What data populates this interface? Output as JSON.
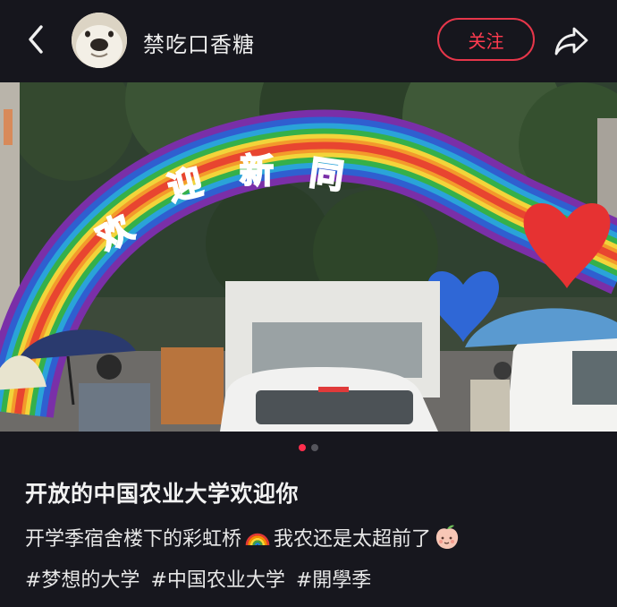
{
  "header": {
    "username": "禁吃口香糖",
    "follow_label": "关注"
  },
  "photo": {
    "arch_text": [
      "欢",
      "迎",
      "新",
      "同"
    ]
  },
  "carousel": {
    "total": 2,
    "active_index": 1
  },
  "post": {
    "title": "开放的中国农业大学欢迎你",
    "desc_before": "开学季宿舍楼下的彩虹桥",
    "desc_after": "我农还是太超前了",
    "emoji_1": "rainbow-icon",
    "emoji_2": "peach-face-icon",
    "tags": [
      "#梦想的大学",
      "#中国农业大学",
      "#開學季"
    ]
  },
  "colors": {
    "background": "#17171e",
    "accent": "#ff3b4f",
    "text": "#e8e8e8"
  }
}
